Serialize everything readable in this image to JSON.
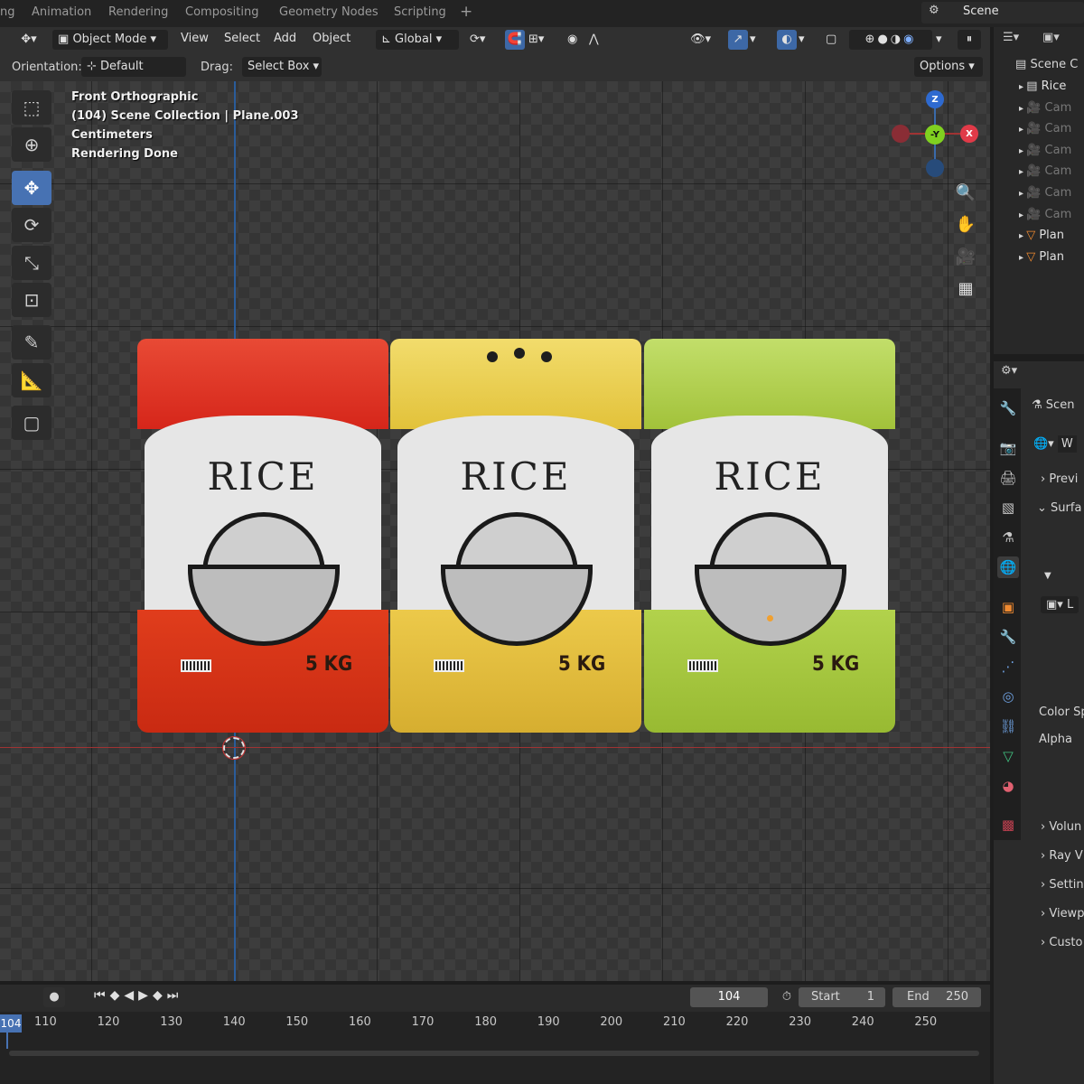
{
  "workspace_tabs": [
    "ng",
    "Animation",
    "Rendering",
    "Compositing",
    "Geometry Nodes",
    "Scripting"
  ],
  "scene_name": "Scene",
  "header": {
    "mode": "Object Mode",
    "menus": [
      "View",
      "Select",
      "Add",
      "Object"
    ],
    "transform_orientation": "Global",
    "orientation_label": "Orientation:",
    "orientation_value": "Default",
    "drag_label": "Drag:",
    "drag_value": "Select Box",
    "options": "Options"
  },
  "viewport_info": [
    "Front Orthographic",
    "(104) Scene Collection | Plane.003",
    "Centimeters",
    "Rendering Done"
  ],
  "gizmo": {
    "z": "Z",
    "y": "-Y",
    "x": "X"
  },
  "bags": [
    {
      "title": "RICE",
      "weight": "5 KG",
      "color": "#d6261a",
      "bottom": "#d83a18"
    },
    {
      "title": "RICE",
      "weight": "5 KG",
      "color": "#e8c838",
      "bottom": "#e2bd3a"
    },
    {
      "title": "RICE",
      "weight": "5 KG",
      "color": "#a8c83e",
      "bottom": "#a4c83a"
    }
  ],
  "timeline": {
    "current": "104",
    "start_label": "Start",
    "start": "1",
    "end_label": "End",
    "end": "250",
    "frame_marker": "104",
    "ticks": [
      "110",
      "120",
      "130",
      "140",
      "150",
      "160",
      "170",
      "180",
      "190",
      "200",
      "210",
      "220",
      "230",
      "240",
      "250"
    ]
  },
  "outliner": {
    "root": "Scene C",
    "items": [
      "Rice",
      "Cam",
      "Cam",
      "Cam",
      "Cam",
      "Cam",
      "Cam",
      "Plan",
      "Plan"
    ]
  },
  "properties": {
    "scene_label": "Scen",
    "world_label": "W",
    "panels": [
      "Previ",
      "Surfa",
      "Volun",
      "Ray V",
      "Settin",
      "Viewp",
      "Custo"
    ],
    "fields": [
      "Color Sp",
      "Alpha"
    ],
    "dropdown": "L"
  }
}
